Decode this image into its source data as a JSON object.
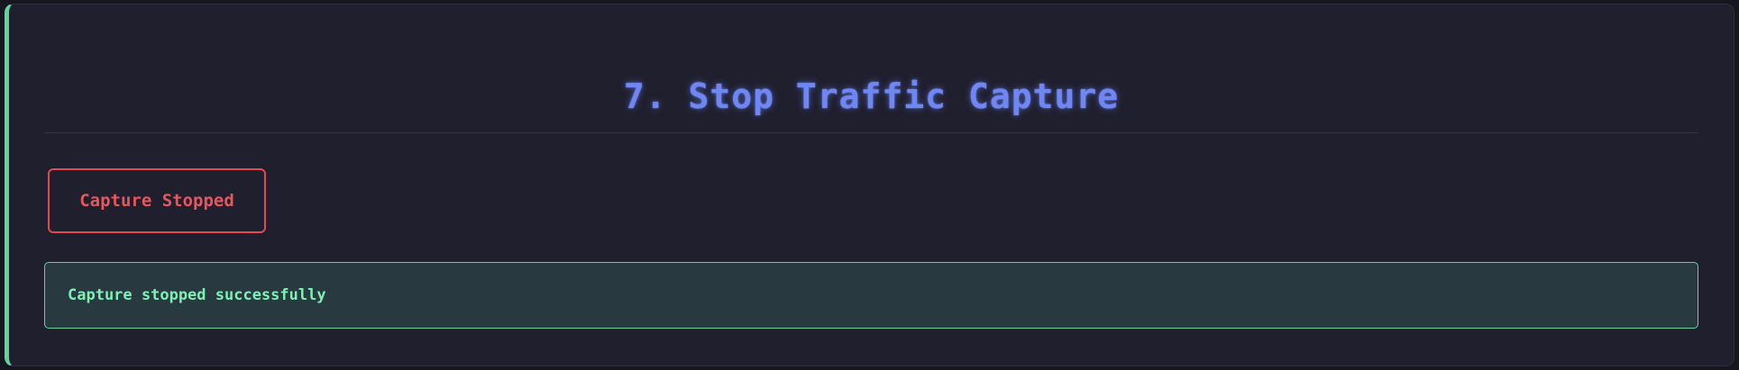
{
  "section": {
    "title": "7. Stop Traffic Capture"
  },
  "actions": {
    "stop_button_label": "Capture Stopped"
  },
  "status": {
    "message": "Capture stopped successfully"
  },
  "colors": {
    "accent_border": "#5fd39a",
    "title": "#6f86f5",
    "danger": "#e5484d",
    "success_text": "#7ef0b4",
    "success_bg": "#283a40",
    "panel_bg": "#1f1f2e"
  }
}
